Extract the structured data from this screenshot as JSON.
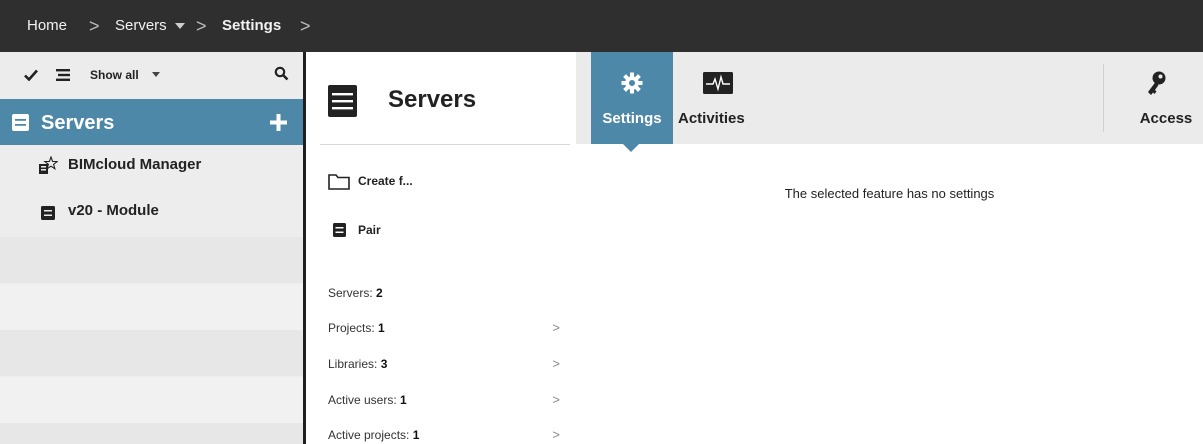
{
  "breadcrumb": {
    "items": [
      {
        "label": "Home"
      },
      {
        "label": "Servers"
      },
      {
        "label": "Settings"
      }
    ],
    "separator": ">"
  },
  "left_panel": {
    "toolbar": {
      "show_all_label": "Show all"
    },
    "section_title": "Servers",
    "tree_items": [
      {
        "label": "BIMcloud Manager",
        "icon": "manager-star-icon"
      },
      {
        "label": "v20 - Module",
        "icon": "module-icon"
      }
    ]
  },
  "middle_panel": {
    "title": "Servers",
    "actions": [
      {
        "label": "Create f...",
        "icon": "folder-icon"
      },
      {
        "label": "Pair",
        "icon": "server-icon"
      }
    ],
    "stats": [
      {
        "label": "Servers:",
        "value": "2",
        "has_chevron": false
      },
      {
        "label": "Projects:",
        "value": "1",
        "has_chevron": true
      },
      {
        "label": "Libraries:",
        "value": "3",
        "has_chevron": true
      },
      {
        "label": "Active users:",
        "value": "1",
        "has_chevron": true
      },
      {
        "label": "Active projects:",
        "value": "1",
        "has_chevron": true
      }
    ]
  },
  "right_panel": {
    "tabs": [
      {
        "label": "Settings",
        "icon": "gear-icon",
        "active": true
      },
      {
        "label": "Activities",
        "icon": "activity-monitor-icon",
        "active": false
      },
      {
        "label": "Access",
        "icon": "key-icon",
        "active": false
      }
    ],
    "empty_message": "The selected feature has no settings"
  },
  "colors": {
    "topbar": "#2f2f2f",
    "accent": "#4e88a8",
    "panel_bg": "#ededed"
  }
}
